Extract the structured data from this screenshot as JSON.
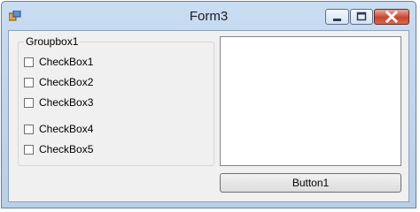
{
  "window": {
    "title": "Form3",
    "controls": [
      {
        "name": "minimize-button",
        "icon": "minimize-icon"
      },
      {
        "name": "maximize-button",
        "icon": "maximize-icon"
      },
      {
        "name": "close-button",
        "icon": "close-icon"
      }
    ],
    "colors": {
      "titlebar": "#c8dcf2",
      "client": "#f0f0f0",
      "close": "#c9452f"
    }
  },
  "groupbox": {
    "label": "Groupbox1",
    "checkboxes": [
      {
        "label": "CheckBox1",
        "checked": false
      },
      {
        "label": "CheckBox2",
        "checked": false
      },
      {
        "label": "CheckBox3",
        "checked": false
      },
      {
        "label": "CheckBox4",
        "checked": false
      },
      {
        "label": "CheckBox5",
        "checked": false
      }
    ]
  },
  "listbox": {
    "items": []
  },
  "button1": {
    "label": "Button1"
  }
}
